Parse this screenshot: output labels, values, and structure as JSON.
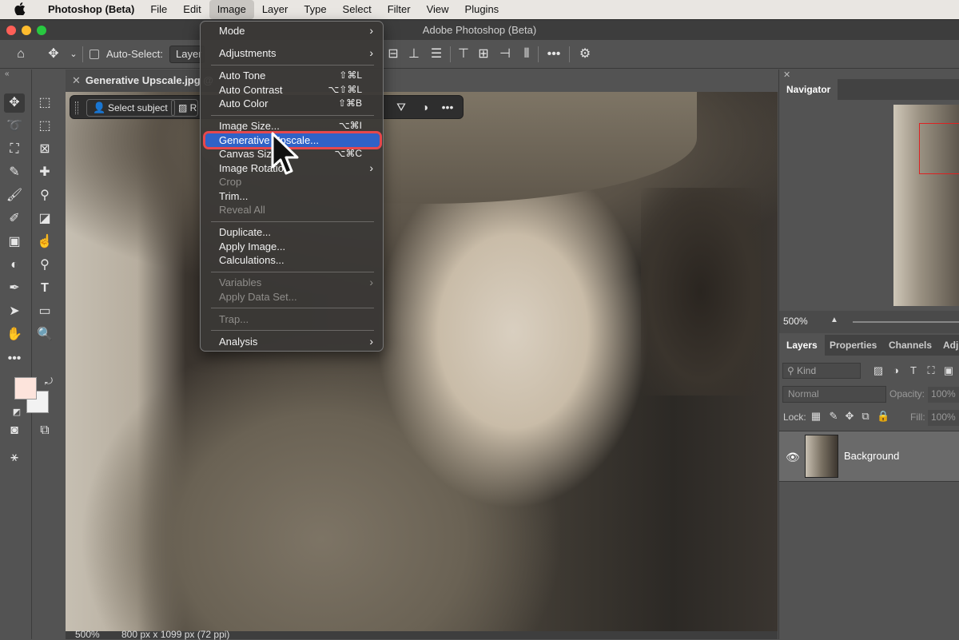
{
  "mac_menu": {
    "app_name": "Photoshop (Beta)",
    "items": [
      "File",
      "Edit",
      "Image",
      "Layer",
      "Type",
      "Select",
      "Filter",
      "View",
      "Plugins"
    ],
    "active_item": "Image"
  },
  "window": {
    "title": "Adobe Photoshop (Beta)"
  },
  "options_bar": {
    "auto_select_label": "Auto-Select:",
    "auto_select_value": "Layer"
  },
  "document_tab": {
    "title": "Generative Upscale.jpg @"
  },
  "contextual_bar": {
    "select_subject_label": "Select subject",
    "second_button_label": "R"
  },
  "image_menu": {
    "items": [
      {
        "label": "Mode",
        "shortcut": "",
        "submenu": true,
        "disabled": false
      },
      {
        "label": "Adjustments",
        "shortcut": "",
        "submenu": true,
        "disabled": false
      },
      {
        "label": "Auto Tone",
        "shortcut": "⇧⌘L",
        "submenu": false,
        "disabled": false
      },
      {
        "label": "Auto Contrast",
        "shortcut": "⌥⇧⌘L",
        "submenu": false,
        "disabled": false
      },
      {
        "label": "Auto Color",
        "shortcut": "⇧⌘B",
        "submenu": false,
        "disabled": false
      },
      {
        "label": "Image Size...",
        "shortcut": "⌥⌘I",
        "submenu": false,
        "disabled": false
      },
      {
        "label": "Generative Upscale...",
        "shortcut": "",
        "submenu": false,
        "disabled": false,
        "highlighted": true
      },
      {
        "label": "Canvas Size",
        "shortcut": "⌥⌘C",
        "submenu": false,
        "disabled": false
      },
      {
        "label": "Image Rotation",
        "shortcut": "",
        "submenu": true,
        "disabled": false
      },
      {
        "label": "Crop",
        "shortcut": "",
        "submenu": false,
        "disabled": true
      },
      {
        "label": "Trim...",
        "shortcut": "",
        "submenu": false,
        "disabled": false
      },
      {
        "label": "Reveal All",
        "shortcut": "",
        "submenu": false,
        "disabled": true
      },
      {
        "label": "Duplicate...",
        "shortcut": "",
        "submenu": false,
        "disabled": false
      },
      {
        "label": "Apply Image...",
        "shortcut": "",
        "submenu": false,
        "disabled": false
      },
      {
        "label": "Calculations...",
        "shortcut": "",
        "submenu": false,
        "disabled": false
      },
      {
        "label": "Variables",
        "shortcut": "",
        "submenu": true,
        "disabled": true
      },
      {
        "label": "Apply Data Set...",
        "shortcut": "",
        "submenu": false,
        "disabled": true
      },
      {
        "label": "Trap...",
        "shortcut": "",
        "submenu": false,
        "disabled": true
      },
      {
        "label": "Analysis",
        "shortcut": "",
        "submenu": true,
        "disabled": false
      }
    ]
  },
  "navigator": {
    "tab_label": "Navigator",
    "zoom": "500%"
  },
  "layers_panel": {
    "tabs": [
      "Layers",
      "Properties",
      "Channels",
      "Adju"
    ],
    "kind_placeholder": "Kind",
    "blend_mode": "Normal",
    "opacity_label": "Opacity:",
    "opacity_value": "100%",
    "lock_label": "Lock:",
    "fill_label": "Fill:",
    "fill_value": "100%",
    "layers": [
      {
        "name": "Background",
        "visible": true
      }
    ]
  },
  "status_bar": {
    "zoom": "500%",
    "doc_info": "800 px x 1099 px (72 ppi)"
  },
  "colors": {
    "foreground_swatch": "#fde4dc",
    "background_swatch": "#f2f2f2",
    "menu_highlight": "#2f62c7",
    "annotation_outline": "#e5484d"
  }
}
